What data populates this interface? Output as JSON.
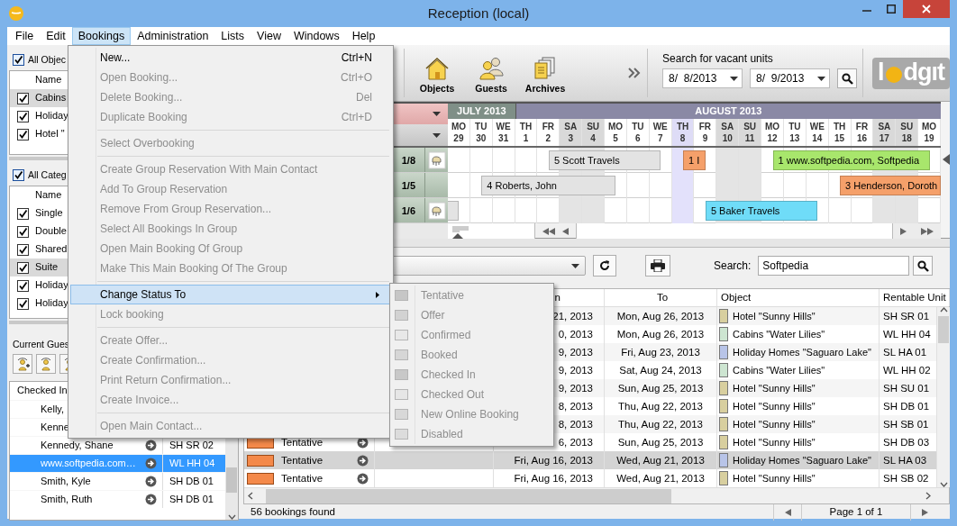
{
  "window": {
    "title": "Reception (local)"
  },
  "menu_bar": [
    {
      "label": "File",
      "selected": false
    },
    {
      "label": "Edit",
      "selected": false
    },
    {
      "label": "Bookings",
      "selected": true
    },
    {
      "label": "Administration",
      "selected": false
    },
    {
      "label": "Lists",
      "selected": false
    },
    {
      "label": "View",
      "selected": false
    },
    {
      "label": "Windows",
      "selected": false
    },
    {
      "label": "Help",
      "selected": false
    }
  ],
  "objects_panel": {
    "all_label": "All Objec",
    "all_checked": true,
    "header": "Name",
    "rows": [
      {
        "label": "Cabins",
        "checked": true,
        "selected": true
      },
      {
        "label": "Holiday",
        "checked": true,
        "selected": false
      },
      {
        "label": "Hotel \"",
        "checked": true,
        "selected": false
      }
    ]
  },
  "categories_panel": {
    "all_label": "All Categ",
    "all_checked": true,
    "header": "Name",
    "rows": [
      {
        "label": "Single",
        "checked": true,
        "selected": false
      },
      {
        "label": "Double",
        "checked": true,
        "selected": false
      },
      {
        "label": "Shared",
        "checked": true,
        "selected": false
      },
      {
        "label": "Suite",
        "checked": true,
        "selected": true
      },
      {
        "label": "Holiday",
        "checked": true,
        "selected": false
      },
      {
        "label": "Holiday",
        "checked": true,
        "selected": false
      }
    ]
  },
  "current_guests": {
    "title": "Current Gues",
    "header": "Checked In",
    "rows": [
      {
        "name": "Kelly,",
        "selected": false
      },
      {
        "name": "Kenne",
        "selected": false
      },
      {
        "name": "Kennedy, Shane",
        "unit": "SH SR 02",
        "selected": false
      },
      {
        "name": "www.softpedia.com…",
        "unit": "WL HH 04",
        "selected": true
      },
      {
        "name": "Smith, Kyle",
        "unit": "SH DB 01",
        "selected": false
      },
      {
        "name": "Smith, Ruth",
        "unit": "SH DB 01",
        "selected": false
      }
    ]
  },
  "toolbar": {
    "buttons": [
      {
        "label": "Objects",
        "kind": "house"
      },
      {
        "label": "Guests",
        "kind": "people"
      },
      {
        "label": "Archives",
        "kind": "documents"
      }
    ],
    "vacant_search": {
      "title": "Search for vacant units",
      "from": "8/  8/2013",
      "to": "8/  9/2013"
    },
    "logo": [
      "l",
      "dg",
      "ıt"
    ]
  },
  "calendar": {
    "months": [
      {
        "label": "JULY 2013",
        "color": "#7f8f87",
        "days": [
          {
            "dow": "MO",
            "date": "29",
            "weekend": false,
            "highlighted": false
          },
          {
            "dow": "TU",
            "date": "30",
            "weekend": false,
            "highlighted": false
          },
          {
            "dow": "WE",
            "date": "31",
            "weekend": false,
            "highlighted": false
          }
        ]
      },
      {
        "label": "AUGUST 2013",
        "color": "#8a89a5",
        "days": [
          {
            "dow": "TH",
            "date": "1",
            "weekend": false,
            "highlighted": false
          },
          {
            "dow": "FR",
            "date": "2",
            "weekend": false,
            "highlighted": false
          },
          {
            "dow": "SA",
            "date": "3",
            "weekend": true,
            "highlighted": false
          },
          {
            "dow": "SU",
            "date": "4",
            "weekend": true,
            "highlighted": false
          },
          {
            "dow": "MO",
            "date": "5",
            "weekend": false,
            "highlighted": false
          },
          {
            "dow": "TU",
            "date": "6",
            "weekend": false,
            "highlighted": false
          },
          {
            "dow": "WE",
            "date": "7",
            "weekend": false,
            "highlighted": false
          },
          {
            "dow": "TH",
            "date": "8",
            "weekend": false,
            "highlighted": true
          },
          {
            "dow": "FR",
            "date": "9",
            "weekend": false,
            "highlighted": false
          },
          {
            "dow": "SA",
            "date": "10",
            "weekend": true,
            "highlighted": false
          },
          {
            "dow": "SU",
            "date": "11",
            "weekend": true,
            "highlighted": false
          },
          {
            "dow": "MO",
            "date": "12",
            "weekend": false,
            "highlighted": false
          },
          {
            "dow": "TU",
            "date": "13",
            "weekend": false,
            "highlighted": false
          },
          {
            "dow": "WE",
            "date": "14",
            "weekend": false,
            "highlighted": false
          },
          {
            "dow": "TH",
            "date": "15",
            "weekend": false,
            "highlighted": false
          },
          {
            "dow": "FR",
            "date": "16",
            "weekend": false,
            "highlighted": false
          },
          {
            "dow": "SA",
            "date": "17",
            "weekend": true,
            "highlighted": false
          },
          {
            "dow": "SU",
            "date": "18",
            "weekend": true,
            "highlighted": false
          },
          {
            "dow": "MO",
            "date": "19",
            "weekend": false,
            "highlighted": false
          }
        ]
      }
    ],
    "rows": [
      {
        "label": "1/8",
        "has_icon": true,
        "bookings": [
          {
            "label": "5 Scott Travels",
            "color": "#e3e3e3"
          },
          {
            "label": "1 I",
            "color": "#f5a06a"
          },
          {
            "label": "1 www.softpedia.com, Softpedia",
            "color": "#a8e66c"
          }
        ]
      },
      {
        "label": "1/5",
        "has_icon": false,
        "bookings": [
          {
            "label": "4 Roberts, John",
            "color": "#e3e3e3"
          },
          {
            "label": "3 Henderson, Doroth",
            "color": "#f5a06a"
          }
        ]
      },
      {
        "label": "1/6",
        "has_icon": true,
        "bookings": [
          {
            "color": "#e3e3e3"
          },
          {
            "label": "5 Baker Travels",
            "color": "#6fdcf8"
          }
        ]
      }
    ]
  },
  "bookings_search": {
    "label": "Search:",
    "value": "Softpedia"
  },
  "bookings_table": {
    "columns": [
      {
        "label": "n"
      },
      {
        "label": "To"
      },
      {
        "label": "Object"
      },
      {
        "label": "Rentable Unit"
      }
    ],
    "rows": [
      {
        "selected": false,
        "from": "21, 2013",
        "to": "Mon, Aug 26, 2013",
        "object": "Hotel \"Sunny Hills\"",
        "color": "#d8cf9f",
        "unit": "SH SR 01"
      },
      {
        "selected": false,
        "from": "0, 2013",
        "to": "Mon, Aug 26, 2013",
        "object": "Cabins \"Water Lilies\"",
        "color": "#cde5d1",
        "unit": "WL HH 04"
      },
      {
        "selected": false,
        "from": "9, 2013",
        "to": "Fri, Aug 23, 2013",
        "object": "Holiday Homes \"Saguaro Lake\"",
        "color": "#b8c4e8",
        "unit": "SL HA 01"
      },
      {
        "selected": false,
        "from": "9, 2013",
        "to": "Sat, Aug 24, 2013",
        "object": "Cabins \"Water Lilies\"",
        "color": "#cde5d1",
        "unit": "WL HH 02"
      },
      {
        "selected": false,
        "from": "9, 2013",
        "to": "Sun, Aug 25, 2013",
        "object": "Hotel \"Sunny Hills\"",
        "color": "#d8cf9f",
        "unit": "SH SU 01"
      },
      {
        "selected": false,
        "from": "8, 2013",
        "to": "Thu, Aug 22, 2013",
        "object": "Hotel \"Sunny Hills\"",
        "color": "#d8cf9f",
        "unit": "SH DB 01"
      },
      {
        "selected": false,
        "from": "8, 2013",
        "to": "Thu, Aug 22, 2013",
        "object": "Hotel \"Sunny Hills\"",
        "color": "#d8cf9f",
        "unit": "SH SB 01"
      },
      {
        "selected": false,
        "status": {
          "label": "Tentative",
          "color": "#f4894a"
        },
        "from": "6, 2013",
        "to": "Sun, Aug 25, 2013",
        "object": "Hotel \"Sunny Hills\"",
        "color": "#d8cf9f",
        "unit": "SH DB 03"
      },
      {
        "selected": true,
        "status": {
          "label": "Tentative",
          "color": "#f4894a"
        },
        "from": "Fri, Aug 16, 2013",
        "to": "Wed, Aug 21, 2013",
        "object": "Holiday Homes \"Saguaro Lake\"",
        "color": "#b8c4e8",
        "unit": "SL HA 03"
      },
      {
        "selected": false,
        "status": {
          "label": "Tentative",
          "color": "#f4894a"
        },
        "from": "Fri, Aug 16, 2013",
        "to": "Wed, Aug 21, 2013",
        "object": "Hotel \"Sunny Hills\"",
        "color": "#d8cf9f",
        "unit": "SH SB 02"
      }
    ]
  },
  "status_bar": {
    "count": "56 bookings found",
    "page": "Page 1 of 1"
  },
  "bookings_menu": {
    "groups": [
      [
        {
          "label": "New...",
          "shortcut": "Ctrl+N",
          "disabled": false,
          "highlighted": false
        },
        {
          "label": "Open Booking...",
          "shortcut": "Ctrl+O",
          "disabled": true,
          "highlighted": false
        },
        {
          "label": "Delete Booking...",
          "shortcut": "Del",
          "disabled": true,
          "highlighted": false
        },
        {
          "label": "Duplicate Booking",
          "shortcut": "Ctrl+D",
          "disabled": true,
          "highlighted": false
        }
      ],
      [
        {
          "label": "Select Overbooking",
          "disabled": true,
          "highlighted": false
        }
      ],
      [
        {
          "label": "Create Group Reservation With Main Contact",
          "disabled": true,
          "highlighted": false
        },
        {
          "label": "Add To Group Reservation",
          "disabled": true,
          "highlighted": false
        },
        {
          "label": "Remove From Group Reservation...",
          "disabled": true,
          "highlighted": false
        },
        {
          "label": "Select All Bookings In Group",
          "disabled": true,
          "highlighted": false
        },
        {
          "label": "Open Main Booking Of Group",
          "disabled": true,
          "highlighted": false
        },
        {
          "label": "Make This Main Booking Of The Group",
          "disabled": true,
          "highlighted": false
        }
      ],
      [
        {
          "label": "Change Status To",
          "disabled": false,
          "highlighted": true,
          "submenu": true
        },
        {
          "label": "Lock booking",
          "disabled": true,
          "highlighted": false
        }
      ],
      [
        {
          "label": "Create Offer...",
          "disabled": true,
          "highlighted": false
        },
        {
          "label": "Create Confirmation...",
          "disabled": true,
          "highlighted": false
        },
        {
          "label": "Print Return Confirmation...",
          "disabled": true,
          "highlighted": false
        },
        {
          "label": "Create Invoice...",
          "disabled": true,
          "highlighted": false
        }
      ],
      [
        {
          "label": "Open Main Contact...",
          "disabled": true,
          "highlighted": false
        }
      ]
    ]
  },
  "status_submenu": {
    "items": [
      {
        "label": "Tentative",
        "color": "#c6c6c6",
        "disabled": true
      },
      {
        "label": "Offer",
        "color": "#d2d2d2",
        "disabled": true
      },
      {
        "label": "Confirmed",
        "color": "#e8e8e8",
        "disabled": true
      },
      {
        "label": "Booked",
        "color": "#d6d6d6",
        "disabled": true
      },
      {
        "label": "Checked In",
        "color": "#c8c8c8",
        "disabled": true
      },
      {
        "label": "Checked Out",
        "color": "#e6e6e6",
        "disabled": true
      },
      {
        "label": "New Online Booking",
        "color": "#d8d8d8",
        "disabled": true
      },
      {
        "label": "Disabled",
        "color": "#dcdcdc",
        "disabled": true
      }
    ]
  }
}
